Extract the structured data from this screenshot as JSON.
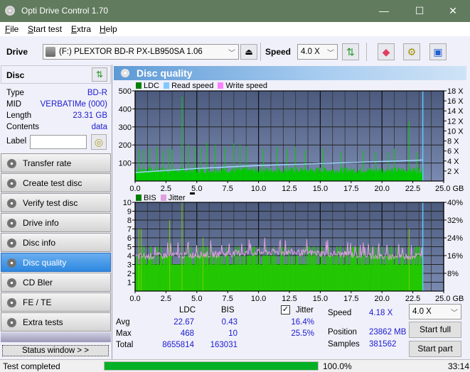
{
  "window": {
    "title": "Opti Drive Control 1.70",
    "minimize": "—",
    "maximize": "☐",
    "close": "✕"
  },
  "menu": [
    {
      "label": "File",
      "key": "F",
      "rest": "ile"
    },
    {
      "label": "Start test",
      "key": "S",
      "rest": "tart test"
    },
    {
      "label": "Extra",
      "key": "E",
      "rest": "xtra"
    },
    {
      "label": "Help",
      "key": "H",
      "rest": "elp"
    }
  ],
  "toolbar": {
    "drive_label": "Drive",
    "drive_value": "(F:)  PLEXTOR BD-R  PX-LB950SA 1.06",
    "speed_label": "Speed",
    "speed_value": "4.0 X"
  },
  "disc": {
    "header": "Disc",
    "rows": [
      {
        "label": "Type",
        "value": "BD-R"
      },
      {
        "label": "MID",
        "value": "VERBATIMe (000)"
      },
      {
        "label": "Length",
        "value": "23.31 GB"
      },
      {
        "label": "Contents",
        "value": "data"
      }
    ],
    "label_field_label": "Label",
    "label_field_value": ""
  },
  "nav": [
    {
      "label": "Transfer rate",
      "active": false
    },
    {
      "label": "Create test disc",
      "active": false
    },
    {
      "label": "Verify test disc",
      "active": false
    },
    {
      "label": "Drive info",
      "active": false
    },
    {
      "label": "Disc info",
      "active": false
    },
    {
      "label": "Disc quality",
      "active": true
    },
    {
      "label": "CD Bler",
      "active": false
    },
    {
      "label": "FE / TE",
      "active": false
    },
    {
      "label": "Extra tests",
      "active": false
    }
  ],
  "status_window_button": "Status window > >",
  "panel_title": "Disc quality",
  "chart_data": [
    {
      "type": "bar",
      "title": "LDC",
      "legend": [
        "LDC",
        "Read speed",
        "Write speed"
      ],
      "legend_colors": {
        "LDC": "#008000",
        "Read speed": "#80c8ff",
        "Write speed": "#ff80ff"
      },
      "xlabel": "GB",
      "x_ticks": [
        "0.0",
        "2.5",
        "5.0",
        "7.5",
        "10.0",
        "12.5",
        "15.0",
        "17.5",
        "20.0",
        "22.5",
        "25.0 GB"
      ],
      "xlim": [
        0,
        25
      ],
      "y_ticks_left": [
        "500",
        "400",
        "300",
        "200",
        "100"
      ],
      "ylim_left": [
        0,
        500
      ],
      "y_ticks_right": [
        "18 X",
        "16 X",
        "14 X",
        "12 X",
        "10 X",
        "8 X",
        "6 X",
        "4 X",
        "2 X"
      ],
      "ylim_right": [
        0,
        18
      ],
      "ldc_baseline_approx": 60,
      "ldc_max": 468,
      "ldc_spikes": [
        [
          0.3,
          180
        ],
        [
          0.7,
          170
        ],
        [
          1.2,
          185
        ],
        [
          1.8,
          190
        ],
        [
          2.3,
          170
        ],
        [
          2.7,
          190
        ],
        [
          3.0,
          175
        ],
        [
          3.8,
          468
        ],
        [
          4.3,
          200
        ],
        [
          4.8,
          190
        ],
        [
          5.3,
          190
        ],
        [
          5.8,
          210
        ],
        [
          6.5,
          200
        ],
        [
          7.3,
          190
        ],
        [
          8.0,
          210
        ],
        [
          8.5,
          200
        ],
        [
          9.0,
          190
        ],
        [
          10.4,
          180
        ],
        [
          11.5,
          190
        ],
        [
          12.3,
          180
        ],
        [
          13.0,
          190
        ],
        [
          13.8,
          170
        ],
        [
          15.2,
          180
        ],
        [
          16.7,
          160
        ],
        [
          18.5,
          170
        ],
        [
          19.5,
          160
        ],
        [
          20.5,
          160
        ],
        [
          21.0,
          180
        ],
        [
          22.2,
          330
        ],
        [
          22.8,
          160
        ]
      ],
      "read_speed_x": [
        0,
        2.5,
        5,
        7.5,
        10,
        12.5,
        15,
        17.5,
        20,
        22.5,
        23.3
      ],
      "read_speed_y": [
        1.7,
        2.1,
        2.5,
        2.8,
        3.1,
        3.3,
        3.5,
        3.7,
        3.9,
        4.1,
        4.2
      ],
      "end_marker_gb": 23.31
    },
    {
      "type": "bar",
      "title": "BIS / Jitter",
      "legend": [
        "BIS",
        "Jitter"
      ],
      "legend_colors": {
        "BIS": "#008000",
        "Jitter": "#e0a0e0"
      },
      "xlabel": "GB",
      "x_ticks": [
        "0.0",
        "2.5",
        "5.0",
        "7.5",
        "10.0",
        "12.5",
        "15.0",
        "17.5",
        "20.0",
        "22.5",
        "25.0 GB"
      ],
      "xlim": [
        0,
        25
      ],
      "y_ticks_left": [
        "10",
        "9",
        "8",
        "7",
        "6",
        "5",
        "4",
        "3",
        "2",
        "1"
      ],
      "ylim_left": [
        0,
        10
      ],
      "y_ticks_right": [
        "40%",
        "32%",
        "24%",
        "16%",
        "8%"
      ],
      "ylim_right": [
        0,
        40
      ],
      "bis_baseline": 3,
      "bis_max": 10,
      "jitter_x": [
        0,
        2.5,
        5,
        7.5,
        10,
        12.5,
        15,
        17.5,
        20,
        22.5,
        23.3
      ],
      "jitter_y": [
        15.5,
        16,
        16.3,
        16.8,
        17.5,
        17.5,
        17,
        16.5,
        15.5,
        15.8,
        16
      ],
      "end_marker_gb": 23.31
    }
  ],
  "results": {
    "headers": [
      "",
      "LDC",
      "BIS"
    ],
    "rows": [
      {
        "label": "Avg",
        "ldc": "22.67",
        "bis": "0.43",
        "jitter": "16.4%"
      },
      {
        "label": "Max",
        "ldc": "468",
        "bis": "10",
        "jitter": "25.5%"
      },
      {
        "label": "Total",
        "ldc": "8655814",
        "bis": "163031",
        "jitter": ""
      }
    ],
    "jitter_label": "Jitter",
    "jitter_checked": true,
    "speed_label": "Speed",
    "speed_value": "4.18 X",
    "position_label": "Position",
    "position_value": "23862 MB",
    "samples_label": "Samples",
    "samples_value": "381562",
    "speed_select": "4.0 X",
    "start_full": "Start full",
    "start_part": "Start part"
  },
  "status": {
    "text": "Test completed",
    "progress_percent": 100.0,
    "progress_label": "100.0%",
    "time": "33:14"
  }
}
